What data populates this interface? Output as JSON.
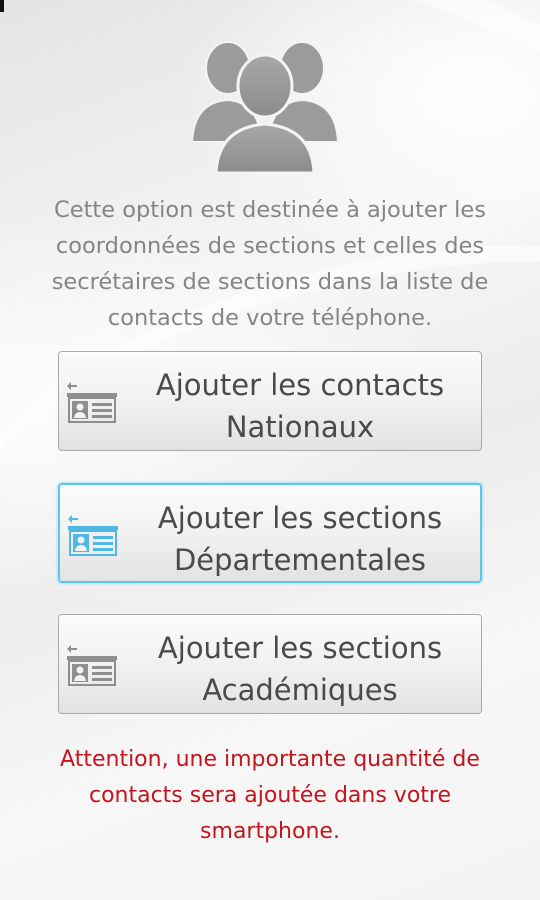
{
  "header": {
    "illustration": "people-group-icon"
  },
  "intro": {
    "lines": [
      "Cette option est destinée à ajouter les",
      "coordonnées de sections et celles des",
      "secrétaires de sections dans la liste de",
      "contacts de votre téléphone."
    ]
  },
  "buttons": [
    {
      "icon": "contact-card-icon",
      "line1": "Ajouter les contacts",
      "line2": "Nationaux",
      "focused": false
    },
    {
      "icon": "contact-card-icon",
      "line1": "Ajouter les sections",
      "line2": "Départementales",
      "focused": true
    },
    {
      "icon": "contact-card-icon",
      "line1": "Ajouter les sections",
      "line2": "Académiques",
      "focused": false
    }
  ],
  "warning": {
    "lines": [
      "Attention, une importante quantité de",
      "contacts sera ajoutée dans votre",
      "smartphone."
    ]
  },
  "colors": {
    "intro_text": "#858585",
    "button_text": "#4a4a4a",
    "focus_border": "#5cc7ec",
    "focused_icon": "#4fb8e3",
    "warning_text": "#c4151c",
    "icon_gray": "#8e8e8e"
  }
}
